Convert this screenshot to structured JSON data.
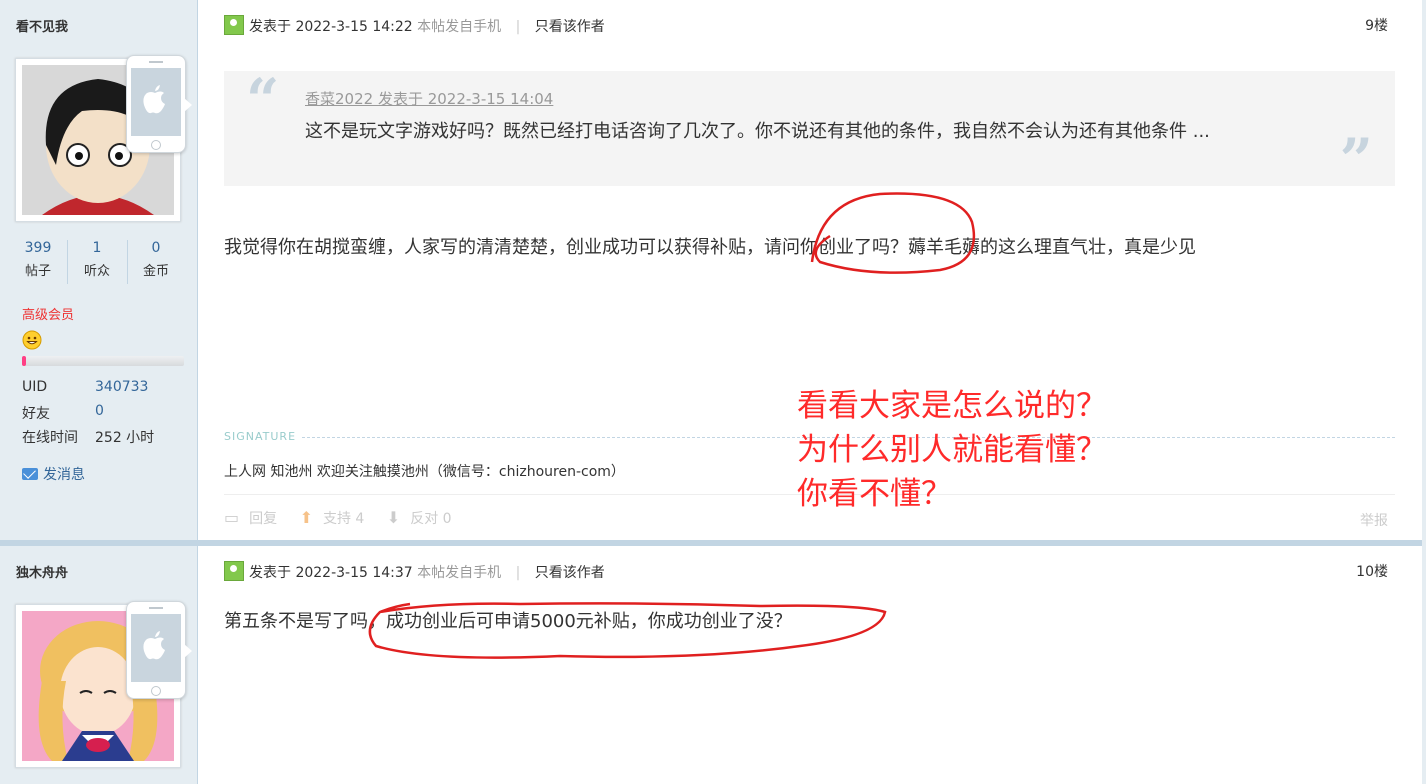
{
  "posts": [
    {
      "author": "看不见我",
      "stats": [
        {
          "num": "399",
          "label": "帖子"
        },
        {
          "num": "1",
          "label": "听众"
        },
        {
          "num": "0",
          "label": "金币"
        }
      ],
      "rank": "高级会员",
      "info": [
        {
          "label": "UID",
          "value": "340733"
        },
        {
          "label": "好友",
          "value": "0"
        },
        {
          "label": "在线时间",
          "value": "252 小时"
        }
      ],
      "send_message": "发消息",
      "meta": {
        "posted": "发表于 2022-3-15 14:22",
        "from_mobile": "本帖发自手机",
        "only_author": "只看该作者"
      },
      "floor": "9楼",
      "quote": {
        "header": "香菜2022 发表于 2022-3-15 14:04",
        "text": "这不是玩文字游戏好吗？既然已经打电话咨询了几次了。你不说还有其他的条件，我自然不会认为还有其他条件 ..."
      },
      "body": "我觉得你在胡搅蛮缠，人家写的清清楚楚，创业成功可以获得补贴，请问你创业了吗？薅羊毛薅的这么理直气壮，真是少见",
      "signature_label": "SIGNATURE",
      "signature": "上人网 知池州 欢迎关注触摸池州（微信号：chizhouren-com）",
      "actions": {
        "reply": "回复",
        "support": "支持 4",
        "oppose": "反对 0",
        "report": "举报"
      }
    },
    {
      "author": "独木舟舟",
      "meta": {
        "posted": "发表于 2022-3-15 14:37",
        "from_mobile": "本帖发自手机",
        "only_author": "只看该作者"
      },
      "floor": "10楼",
      "body": "第五条不是写了吗，成功创业后可申请5000元补贴，你成功创业了没？"
    }
  ],
  "annotation": {
    "lines": [
      "看看大家是怎么说的？",
      "为什么别人就能看懂？",
      "你看不懂？"
    ],
    "color": "#ff2a2a"
  },
  "colors": {
    "sidebar": "#e5edf2",
    "link": "#336699",
    "rank": "#ee3333",
    "quote_bg": "#f4f4f4"
  }
}
